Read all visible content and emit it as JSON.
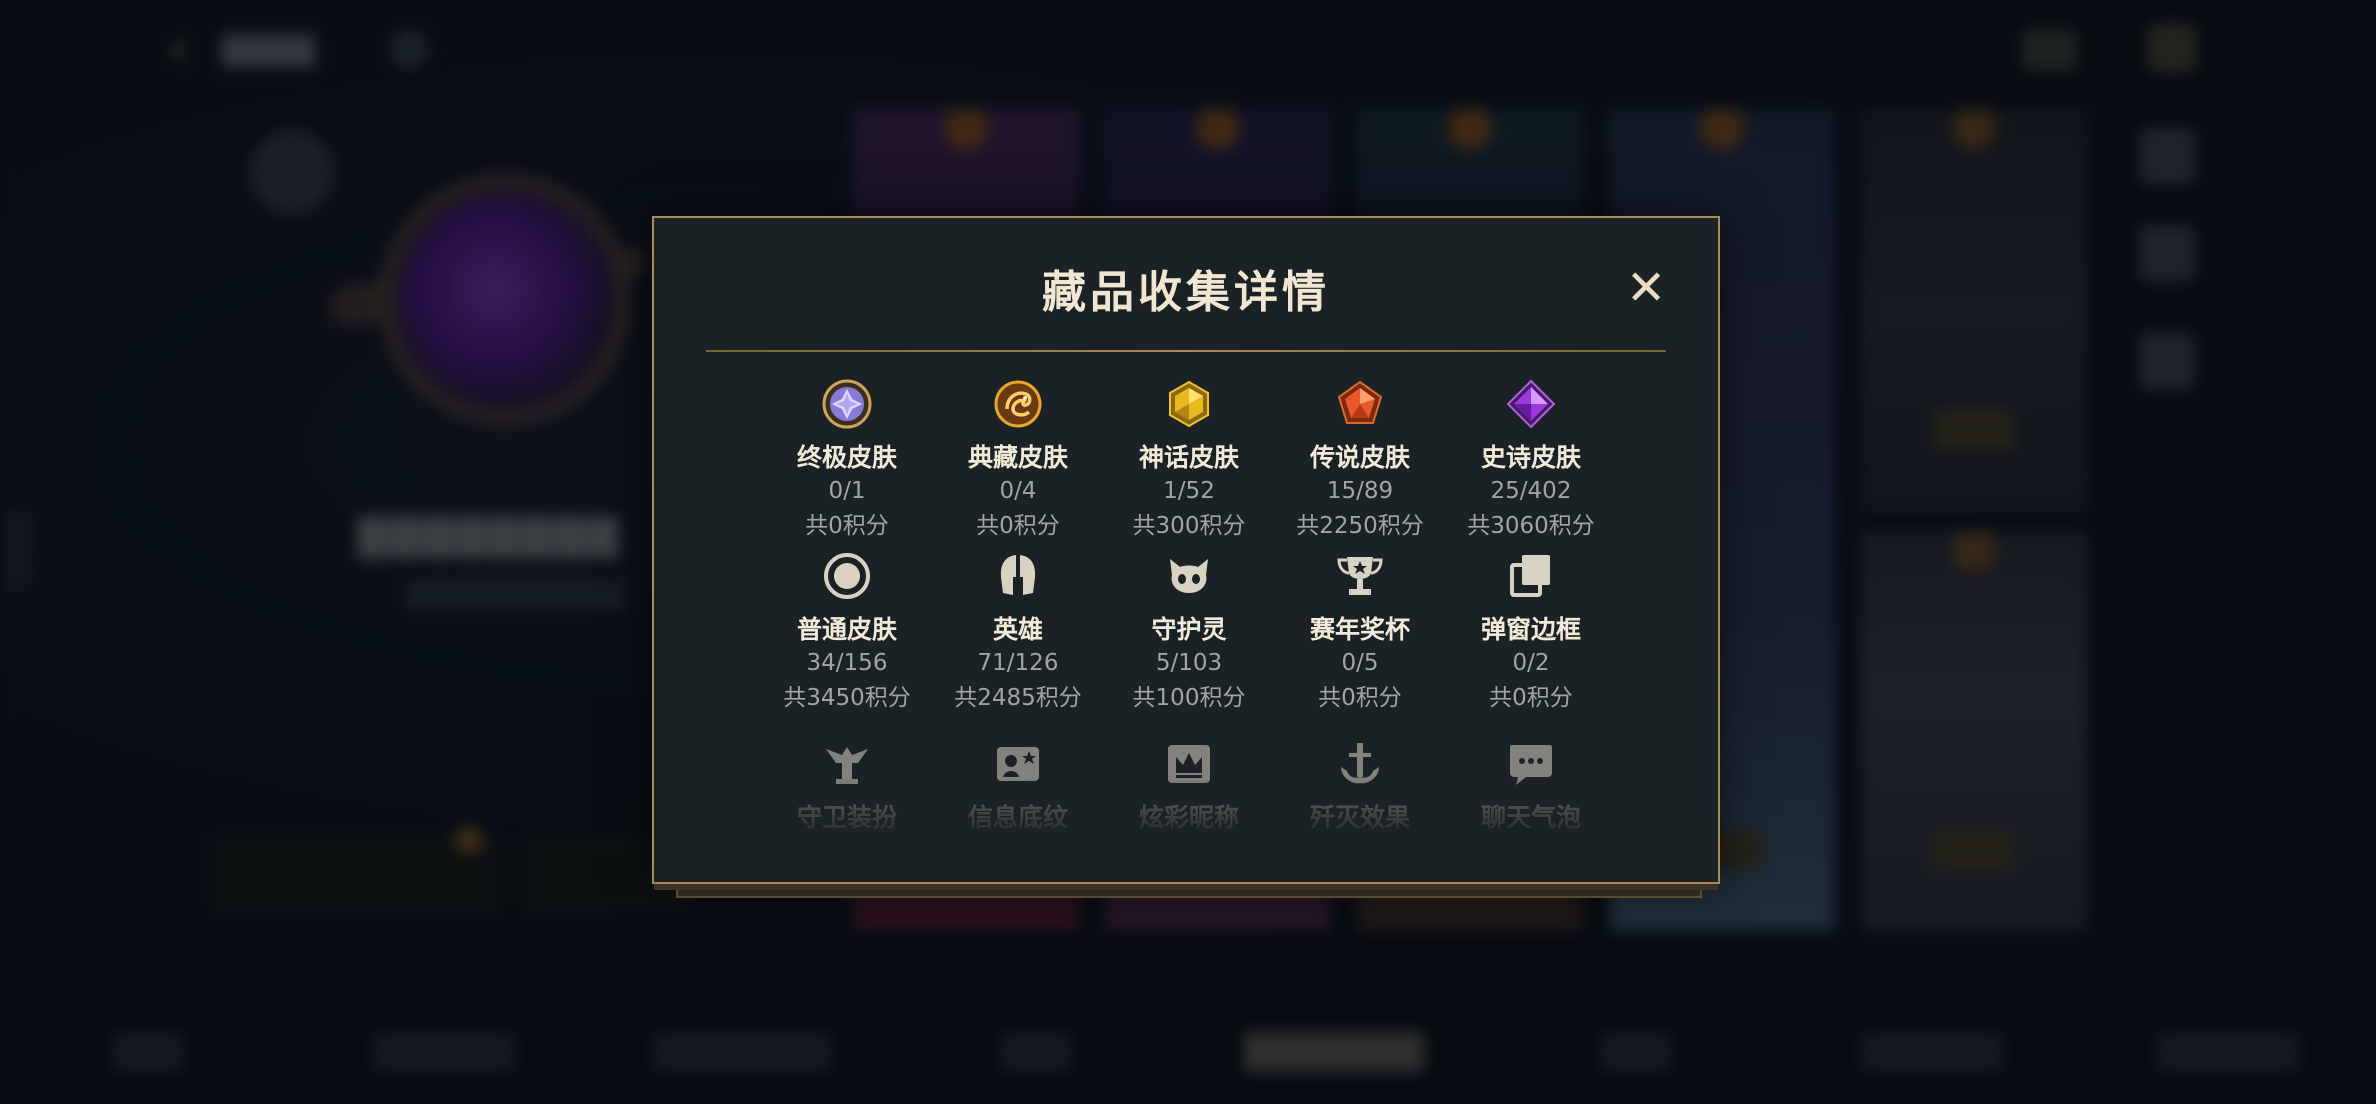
{
  "modal": {
    "title": "藏品收集详情",
    "close_label": "✕",
    "categories": [
      {
        "name": "终极皮肤",
        "count": "0/1",
        "points": "共0积分",
        "icon": "ultimate-skin-icon"
      },
      {
        "name": "典藏皮肤",
        "count": "0/4",
        "points": "共0积分",
        "icon": "prestige-skin-icon"
      },
      {
        "name": "神话皮肤",
        "count": "1/52",
        "points": "共300积分",
        "icon": "mythic-skin-icon"
      },
      {
        "name": "传说皮肤",
        "count": "15/89",
        "points": "共2250积分",
        "icon": "legendary-skin-icon"
      },
      {
        "name": "史诗皮肤",
        "count": "25/402",
        "points": "共3060积分",
        "icon": "epic-skin-icon"
      },
      {
        "name": "普通皮肤",
        "count": "34/156",
        "points": "共3450积分",
        "icon": "standard-skin-icon"
      },
      {
        "name": "英雄",
        "count": "71/126",
        "points": "共2485积分",
        "icon": "champion-helmet-icon"
      },
      {
        "name": "守护灵",
        "count": "5/103",
        "points": "共100积分",
        "icon": "little-legend-icon"
      },
      {
        "name": "赛年奖杯",
        "count": "0/5",
        "points": "共0积分",
        "icon": "trophy-icon"
      },
      {
        "name": "弹窗边框",
        "count": "0/2",
        "points": "共0积分",
        "icon": "popup-frame-icon"
      },
      {
        "name": "守卫装扮",
        "icon": "ward-skin-icon"
      },
      {
        "name": "信息底纹",
        "icon": "banner-icon"
      },
      {
        "name": "炫彩昵称",
        "icon": "nickname-icon"
      },
      {
        "name": "歼灭效果",
        "icon": "ace-effect-icon"
      },
      {
        "name": "聊天气泡",
        "icon": "chat-bubble-icon"
      }
    ]
  },
  "colors": {
    "modal_bg": "#1b2226",
    "modal_border": "#a88a52",
    "title_text": "#f0e6d2",
    "secondary_text": "#9ea4a8"
  }
}
